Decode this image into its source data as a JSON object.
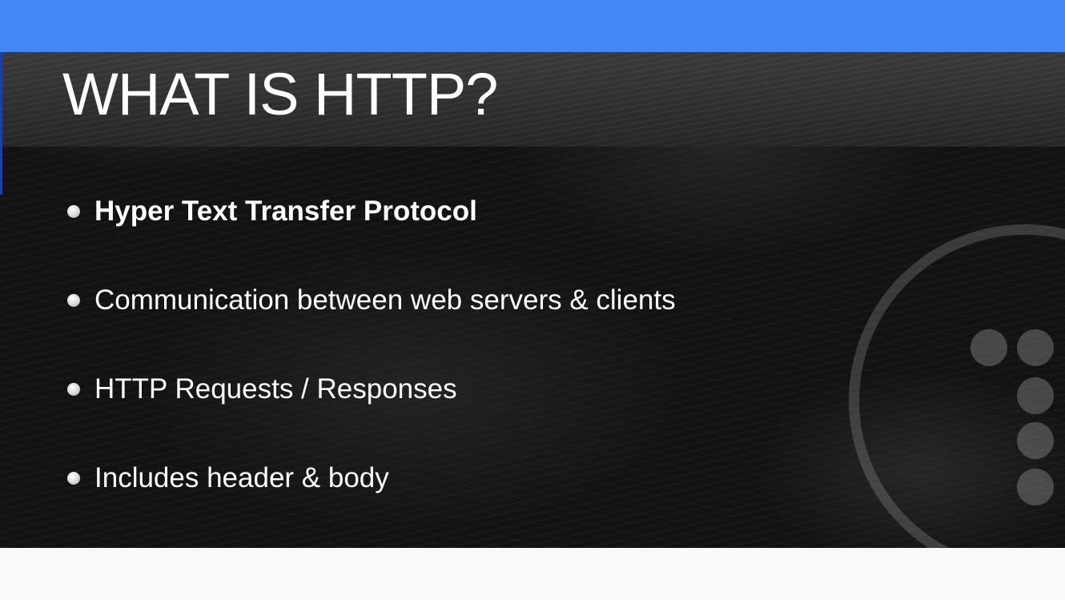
{
  "slide": {
    "title": "WHAT IS HTTP?",
    "bullets": [
      {
        "text": "Hyper Text Transfer Protocol",
        "bold": true
      },
      {
        "text": "Communication between web servers & clients",
        "bold": false
      },
      {
        "text": "HTTP Requests / Responses",
        "bold": false
      },
      {
        "text": "Includes header & body",
        "bold": false
      }
    ]
  },
  "colors": {
    "top_bar": "#4285f4",
    "slide_background": "#121212",
    "title_band": "#2e2e2e",
    "text": "#ffffff",
    "page_background": "#f9f9f9"
  },
  "decorations": {
    "ring": "circle-outline",
    "dots": "dot-grid"
  }
}
